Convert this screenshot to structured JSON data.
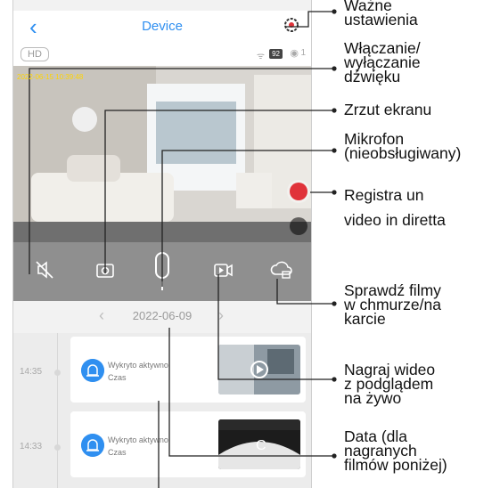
{
  "app": {
    "title": "Device",
    "quality": "HD",
    "battery": "92",
    "viewers": "1",
    "timestamp": "2022-06-15  10:39:48"
  },
  "date_bar": {
    "prev": "‹",
    "date": "2022-06-09",
    "next": "›"
  },
  "events": [
    {
      "time": "14:35",
      "title": "Wykryto aktywno",
      "subtitle": "Czas"
    },
    {
      "time": "14:33",
      "title": "Wykryto aktywno",
      "subtitle": "Czas"
    }
  ],
  "annotations": {
    "settings": "Ważne\nustawienia",
    "sound": "Włączanie/\nwyłączanie\ndźwięku",
    "screenshot": "Zrzut ekranu",
    "mic": "Mikrofon\n(nieobsługiwany)",
    "record": "Registra un\nvideo in diretta",
    "playback": "Sprawdź filmy\nw chmurze/na\nkarcie",
    "live_record": "Nagraj wideo\nz podglądem\nna żywo",
    "date": "Data (dla\nnagranych\nfilmów poniżej)"
  },
  "colors": {
    "accent": "#2f8ff0",
    "record": "#e0333a",
    "timestamp": "#ffd400"
  },
  "icons": [
    "back-icon",
    "gear-icon",
    "speaker-mute-icon",
    "camera-icon",
    "mic-icon",
    "video-icon",
    "cloud-icon",
    "alarm-icon",
    "play-icon"
  ]
}
